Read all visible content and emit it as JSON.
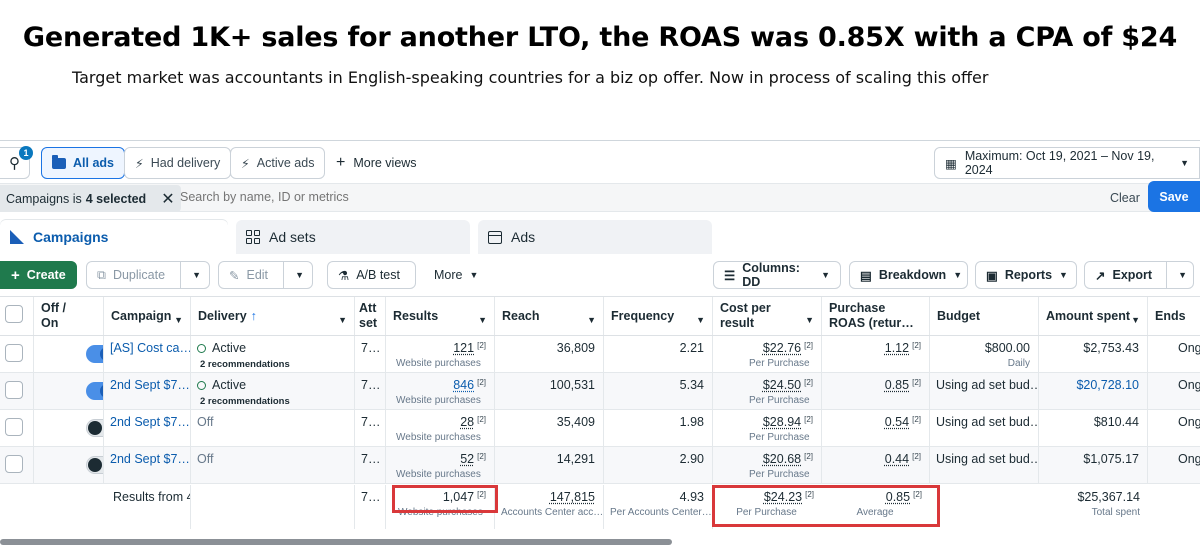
{
  "overlay": {
    "headline": "Generated 1K+ sales for another LTO, the ROAS was 0.85X with a CPA of $24",
    "subline": "Target market was accountants in English-speaking countries for a biz op offer. Now in process of scaling this offer"
  },
  "views": {
    "search_badge": "1",
    "all_ads": "All ads",
    "had_delivery": "Had delivery",
    "active_ads": "Active ads",
    "more_views": "More views",
    "date_range": "Maximum: Oct 19, 2021 – Nov 19, 2024"
  },
  "filter": {
    "chip_prefix": "Campaigns is",
    "chip_value": "4 selected",
    "search_placeholder": "Search by name, ID or metrics",
    "clear": "Clear",
    "save": "Save"
  },
  "tabs": {
    "campaigns": "Campaigns",
    "ad_sets": "Ad sets",
    "ads": "Ads"
  },
  "toolbar": {
    "create": "Create",
    "duplicate": "Duplicate",
    "edit": "Edit",
    "ab_test": "A/B test",
    "more": "More",
    "columns": "Columns: DD",
    "breakdown": "Breakdown",
    "reports": "Reports",
    "export": "Export"
  },
  "table": {
    "headers": {
      "off_on": "Off / On",
      "campaign": "Campaign",
      "delivery": "Delivery",
      "attribution": "Att set",
      "results": "Results",
      "reach": "Reach",
      "frequency": "Frequency",
      "cost_per_result": "Cost per result",
      "roas": "Purchase ROAS (retur…",
      "budget": "Budget",
      "amount_spent": "Amount spent",
      "ends": "Ends"
    },
    "rows": [
      {
        "on": true,
        "campaign": "[AS] Cost ca…",
        "delivery": "Active",
        "recommendations": "2 recommendations",
        "attr": "7…",
        "results": "121",
        "results_sub": "Website purchases",
        "reach": "36,809",
        "frequency": "2.21",
        "cpr": "$22.76",
        "cpr_sub": "Per Purchase",
        "roas": "1.12",
        "budget": "$800.00",
        "budget_sub": "Daily",
        "spent": "$2,753.43",
        "ends": "Ong"
      },
      {
        "on": true,
        "campaign": "2nd Sept $7…",
        "delivery": "Active",
        "recommendations": "2 recommendations",
        "attr": "7…",
        "results": "846",
        "results_sub": "Website purchases",
        "reach": "100,531",
        "frequency": "5.34",
        "cpr": "$24.50",
        "cpr_sub": "Per Purchase",
        "roas": "0.85",
        "budget": "Using ad set bud…",
        "budget_sub": "",
        "spent": "$20,728.10",
        "ends": "Ong"
      },
      {
        "on": false,
        "campaign": "2nd Sept $7…",
        "delivery": "Off",
        "recommendations": "",
        "attr": "7…",
        "results": "28",
        "results_sub": "Website purchases",
        "reach": "35,409",
        "frequency": "1.98",
        "cpr": "$28.94",
        "cpr_sub": "Per Purchase",
        "roas": "0.54",
        "budget": "Using ad set bud…",
        "budget_sub": "",
        "spent": "$810.44",
        "ends": "Ong"
      },
      {
        "on": false,
        "campaign": "2nd Sept $7…",
        "delivery": "Off",
        "recommendations": "",
        "attr": "7…",
        "results": "52",
        "results_sub": "Website purchases",
        "reach": "14,291",
        "frequency": "2.90",
        "cpr": "$20.68",
        "cpr_sub": "Per Purchase",
        "roas": "0.44",
        "budget": "Using ad set bud…",
        "budget_sub": "",
        "spent": "$1,075.17",
        "ends": "Ong"
      }
    ],
    "totals": {
      "label": "Results from 4",
      "attr": "7…",
      "results": "1,047",
      "results_sub": "Website purchases",
      "reach": "147,815",
      "reach_sub": "Accounts Center acc…",
      "frequency": "4.93",
      "frequency_sub": "Per Accounts Center…",
      "cpr": "$24.23",
      "cpr_sub": "Per Purchase",
      "roas": "0.85",
      "roas_sub": "Average",
      "spent": "$25,367.14",
      "spent_sub": "Total spent"
    },
    "footnote_mark": "[2]"
  },
  "colors": {
    "accent": "#1b74e4",
    "create": "#1f7a4d",
    "highlight": "#d9383a"
  }
}
